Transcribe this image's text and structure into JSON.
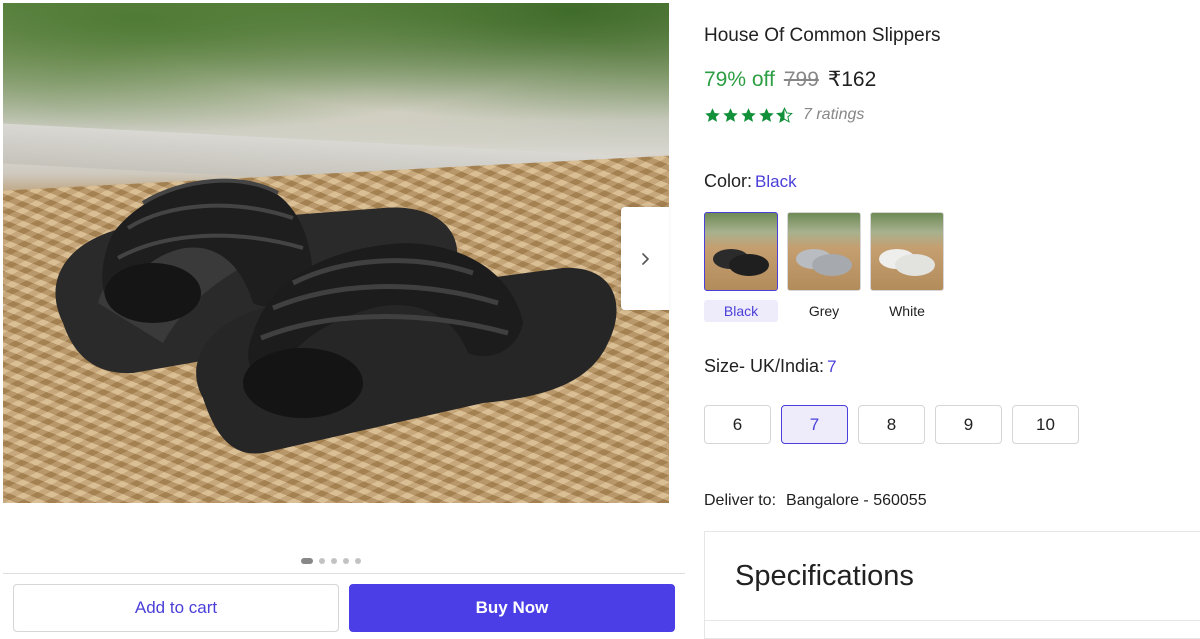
{
  "gallery": {
    "image_alt": "Black pillow slides on a woven mat",
    "dots_count": 5,
    "active_dot": 0,
    "next_icon": "chevron-right-icon"
  },
  "actions": {
    "add_to_cart": "Add to cart",
    "buy_now": "Buy Now"
  },
  "product": {
    "title": "House Of Common Slippers",
    "discount": "79% off",
    "mrp": "799",
    "price": "₹162",
    "rating_stars": 4.5,
    "ratings_text": "7 ratings"
  },
  "color": {
    "label": "Color:",
    "selected": "Black",
    "options": [
      {
        "name": "Black",
        "swatch": "#2b2b2b"
      },
      {
        "name": "Grey",
        "swatch": "#b9bcc0"
      },
      {
        "name": "White",
        "swatch": "#eeeeec"
      }
    ]
  },
  "size": {
    "label": "Size- UK/India:",
    "selected": "7",
    "options": [
      "6",
      "7",
      "8",
      "9",
      "10"
    ]
  },
  "delivery": {
    "label": "Deliver to:",
    "location": "Bangalore - 560055"
  },
  "specifications": {
    "title": "Specifications"
  },
  "colors": {
    "accent": "#4a3fd8",
    "buy_button": "#4b3ee6",
    "discount_green": "#2e9e44",
    "star_green": "#12903a"
  }
}
